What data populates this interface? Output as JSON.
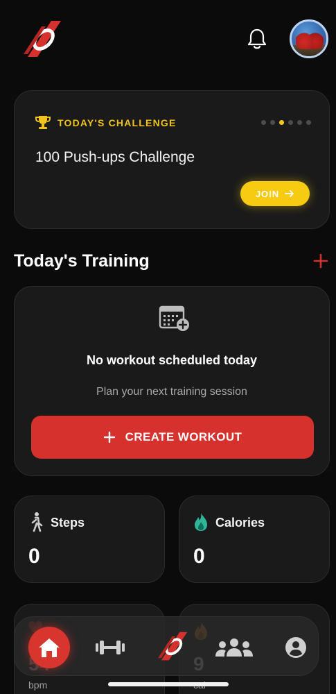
{
  "header": {
    "logo_icon": "brand-logo-icon",
    "notification_icon": "bell-icon",
    "avatar_icon": "avatar"
  },
  "challenge": {
    "label": "TODAY'S CHALLENGE",
    "title": "100 Push-ups Challenge",
    "join_label": "JOIN",
    "carousel_total": 6,
    "carousel_active": 3,
    "accent_color": "#f6cb12"
  },
  "training": {
    "section_title": "Today's Training",
    "empty_title": "No workout scheduled today",
    "empty_subtitle": "Plan your next training session",
    "create_label": "CREATE WORKOUT",
    "create_color": "#d6312c"
  },
  "stats": {
    "steps": {
      "label": "Steps",
      "value": "0"
    },
    "calories": {
      "label": "Calories",
      "value": "0"
    },
    "heart": {
      "value": "54",
      "unit": "bpm"
    },
    "burn": {
      "value": "9",
      "unit": "cal"
    }
  },
  "nav": {
    "items": [
      "home-icon",
      "dumbbell-icon",
      "brand-logo-icon",
      "community-icon",
      "profile-icon"
    ],
    "active_color": "#d8352f"
  }
}
